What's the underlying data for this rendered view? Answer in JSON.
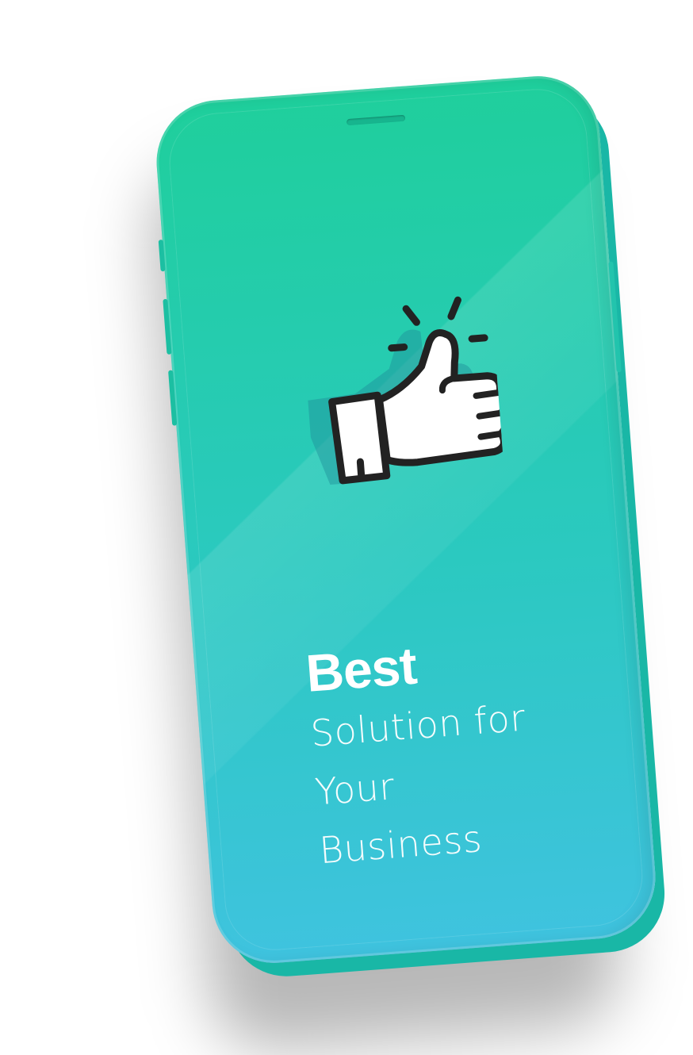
{
  "hero": {
    "title_bold": "Best",
    "title_lines": [
      "Solution for",
      "Your",
      "Business"
    ]
  },
  "icons": {
    "main": "thumbs-up-icon"
  },
  "colors": {
    "gradient_top": "#1fcf9c",
    "gradient_bottom": "#3fc3df",
    "text": "#ffffff"
  }
}
